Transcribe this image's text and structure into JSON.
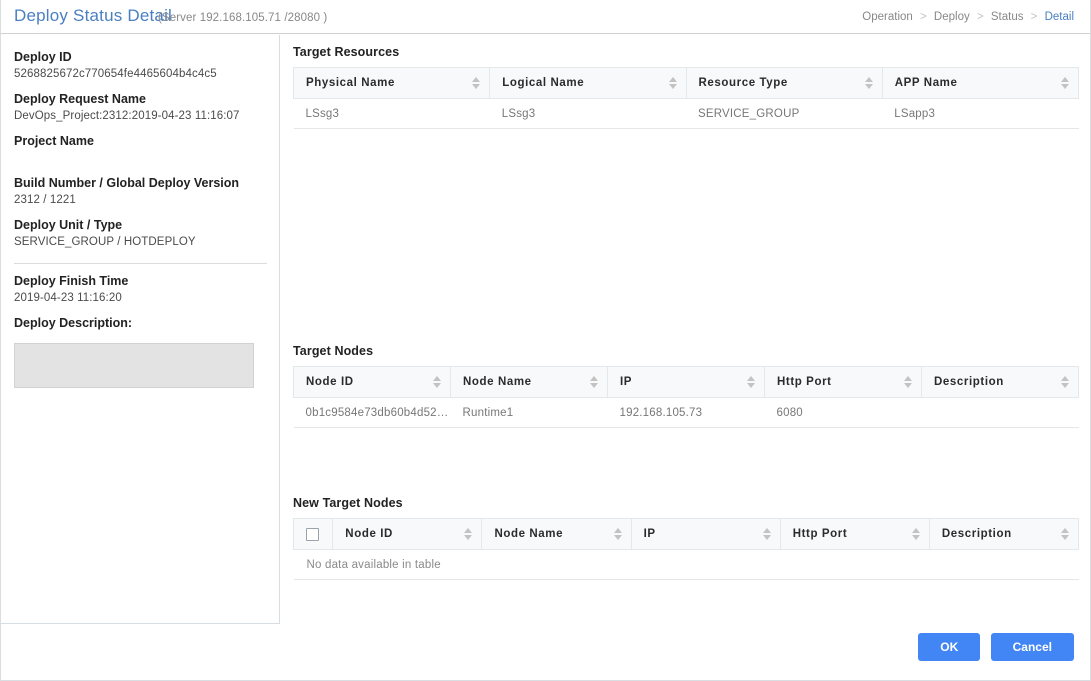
{
  "header": {
    "title": "Deploy Status Detail",
    "server_info": "(Server 192.168.105.71 /28080 )",
    "breadcrumb": [
      {
        "label": "Operation",
        "active": false
      },
      {
        "label": "Deploy",
        "active": false
      },
      {
        "label": "Status",
        "active": false
      },
      {
        "label": "Detail",
        "active": true
      }
    ],
    "breadcrumb_separator": ">"
  },
  "details": {
    "deploy_id_label": "Deploy ID",
    "deploy_id_value": "5268825672c770654fe4465604b4c4c5",
    "deploy_request_name_label": "Deploy Request Name",
    "deploy_request_name_value": "DevOps_Project:2312:2019-04-23 11:16:07",
    "project_name_label": "Project Name",
    "project_name_value": "",
    "build_number_label": "Build Number / Global Deploy Version",
    "build_number_value": "2312 / 1221",
    "deploy_unit_label": "Deploy Unit / Type",
    "deploy_unit_value": "SERVICE_GROUP / HOTDEPLOY",
    "deploy_finish_time_label": "Deploy Finish Time",
    "deploy_finish_time_value": "2019-04-23 11:16:20",
    "deploy_description_label": "Deploy Description:",
    "deploy_description_value": ""
  },
  "target_resources": {
    "title": "Target Resources",
    "columns": [
      "Physical Name",
      "Logical Name",
      "Resource Type",
      "APP Name"
    ],
    "rows": [
      [
        "LSsg3",
        "LSsg3",
        "SERVICE_GROUP",
        "LSapp3"
      ]
    ]
  },
  "target_nodes": {
    "title": "Target Nodes",
    "columns": [
      "Node ID",
      "Node Name",
      "IP",
      "Http Port",
      "Description"
    ],
    "rows": [
      [
        "0b1c9584e73db60b4d529...",
        "Runtime1",
        "192.168.105.73",
        "6080",
        ""
      ]
    ]
  },
  "new_target_nodes": {
    "title": "New Target Nodes",
    "columns": [
      "Node ID",
      "Node Name",
      "IP",
      "Http Port",
      "Description"
    ],
    "rows": [],
    "empty_message": "No data available in table"
  },
  "footer": {
    "ok_label": "OK",
    "cancel_label": "Cancel"
  },
  "colors": {
    "accent": "#4285f4",
    "title": "#4a7fc1",
    "header_bg": "#f7f9fa",
    "border": "#e3e8ea"
  }
}
